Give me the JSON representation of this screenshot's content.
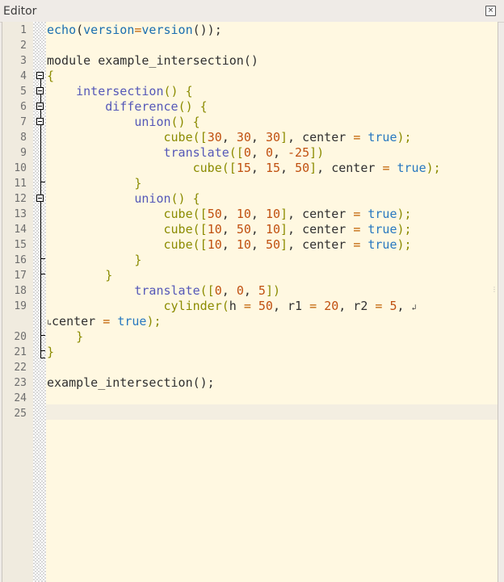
{
  "window": {
    "title": "Editor",
    "close_glyph": "×"
  },
  "gutter": {
    "line_numbers": [
      "1",
      "2",
      "3",
      "4",
      "5",
      "6",
      "7",
      "8",
      "9",
      "10",
      "11",
      "12",
      "13",
      "14",
      "15",
      "16",
      "17",
      "18",
      "19",
      "20",
      "21",
      "22",
      "23",
      "24",
      "25"
    ]
  },
  "code": {
    "lines": [
      [
        [
          "fn",
          "echo"
        ],
        [
          "plain",
          "("
        ],
        [
          "fn",
          "version"
        ],
        [
          "op",
          "="
        ],
        [
          "fn",
          "version"
        ],
        [
          "plain",
          "());"
        ]
      ],
      [],
      [
        [
          "plain",
          "module example_intersection()"
        ]
      ],
      [
        [
          "fn2",
          "{"
        ]
      ],
      [
        [
          "plain",
          "    "
        ],
        [
          "kw",
          "intersection"
        ],
        [
          "fn2",
          "() {"
        ]
      ],
      [
        [
          "plain",
          "        "
        ],
        [
          "kw",
          "difference"
        ],
        [
          "fn2",
          "() {"
        ]
      ],
      [
        [
          "plain",
          "            "
        ],
        [
          "kw",
          "union"
        ],
        [
          "fn2",
          "() {"
        ]
      ],
      [
        [
          "plain",
          "                "
        ],
        [
          "fn2",
          "cube(["
        ],
        [
          "num",
          "30"
        ],
        [
          "plain",
          ", "
        ],
        [
          "num",
          "30"
        ],
        [
          "plain",
          ", "
        ],
        [
          "num",
          "30"
        ],
        [
          "fn2",
          "]"
        ],
        [
          "plain",
          ", center "
        ],
        [
          "op",
          "="
        ],
        [
          "plain",
          " "
        ],
        [
          "bool",
          "true"
        ],
        [
          "fn2",
          ");"
        ]
      ],
      [
        [
          "plain",
          "                "
        ],
        [
          "kw",
          "translate"
        ],
        [
          "fn2",
          "(["
        ],
        [
          "num",
          "0"
        ],
        [
          "plain",
          ", "
        ],
        [
          "num",
          "0"
        ],
        [
          "plain",
          ", "
        ],
        [
          "num",
          "-25"
        ],
        [
          "fn2",
          "])"
        ]
      ],
      [
        [
          "plain",
          "                    "
        ],
        [
          "fn2",
          "cube(["
        ],
        [
          "num",
          "15"
        ],
        [
          "plain",
          ", "
        ],
        [
          "num",
          "15"
        ],
        [
          "plain",
          ", "
        ],
        [
          "num",
          "50"
        ],
        [
          "fn2",
          "]"
        ],
        [
          "plain",
          ", center "
        ],
        [
          "op",
          "="
        ],
        [
          "plain",
          " "
        ],
        [
          "bool",
          "true"
        ],
        [
          "fn2",
          ");"
        ]
      ],
      [
        [
          "plain",
          "            "
        ],
        [
          "fn2",
          "}"
        ]
      ],
      [
        [
          "plain",
          "            "
        ],
        [
          "kw",
          "union"
        ],
        [
          "fn2",
          "() {"
        ]
      ],
      [
        [
          "plain",
          "                "
        ],
        [
          "fn2",
          "cube(["
        ],
        [
          "num",
          "50"
        ],
        [
          "plain",
          ", "
        ],
        [
          "num",
          "10"
        ],
        [
          "plain",
          ", "
        ],
        [
          "num",
          "10"
        ],
        [
          "fn2",
          "]"
        ],
        [
          "plain",
          ", center "
        ],
        [
          "op",
          "="
        ],
        [
          "plain",
          " "
        ],
        [
          "bool",
          "true"
        ],
        [
          "fn2",
          ");"
        ]
      ],
      [
        [
          "plain",
          "                "
        ],
        [
          "fn2",
          "cube(["
        ],
        [
          "num",
          "10"
        ],
        [
          "plain",
          ", "
        ],
        [
          "num",
          "50"
        ],
        [
          "plain",
          ", "
        ],
        [
          "num",
          "10"
        ],
        [
          "fn2",
          "]"
        ],
        [
          "plain",
          ", center "
        ],
        [
          "op",
          "="
        ],
        [
          "plain",
          " "
        ],
        [
          "bool",
          "true"
        ],
        [
          "fn2",
          ");"
        ]
      ],
      [
        [
          "plain",
          "                "
        ],
        [
          "fn2",
          "cube(["
        ],
        [
          "num",
          "10"
        ],
        [
          "plain",
          ", "
        ],
        [
          "num",
          "10"
        ],
        [
          "plain",
          ", "
        ],
        [
          "num",
          "50"
        ],
        [
          "fn2",
          "]"
        ],
        [
          "plain",
          ", center "
        ],
        [
          "op",
          "="
        ],
        [
          "plain",
          " "
        ],
        [
          "bool",
          "true"
        ],
        [
          "fn2",
          ");"
        ]
      ],
      [
        [
          "plain",
          "            "
        ],
        [
          "fn2",
          "}"
        ]
      ],
      [
        [
          "plain",
          "        "
        ],
        [
          "fn2",
          "}"
        ]
      ],
      [
        [
          "plain",
          "            "
        ],
        [
          "kw",
          "translate"
        ],
        [
          "fn2",
          "(["
        ],
        [
          "num",
          "0"
        ],
        [
          "plain",
          ", "
        ],
        [
          "num",
          "0"
        ],
        [
          "plain",
          ", "
        ],
        [
          "num",
          "5"
        ],
        [
          "fn2",
          "])"
        ]
      ],
      [
        [
          "plain",
          "                "
        ],
        [
          "fn2",
          "cylinder("
        ],
        [
          "plain",
          "h "
        ],
        [
          "op",
          "="
        ],
        [
          "plain",
          " "
        ],
        [
          "num",
          "50"
        ],
        [
          "plain",
          ", r1 "
        ],
        [
          "op",
          "="
        ],
        [
          "plain",
          " "
        ],
        [
          "num",
          "20"
        ],
        [
          "plain",
          ", r2 "
        ],
        [
          "op",
          "="
        ],
        [
          "plain",
          " "
        ],
        [
          "num",
          "5"
        ],
        [
          "plain",
          ", "
        ]
      ],
      [
        [
          "plain",
          "center "
        ],
        [
          "op",
          "="
        ],
        [
          "plain",
          " "
        ],
        [
          "bool",
          "true"
        ],
        [
          "fn2",
          ");"
        ]
      ],
      [
        [
          "plain",
          "    "
        ],
        [
          "fn2",
          "}"
        ]
      ],
      [
        [
          "fn2",
          "}"
        ]
      ],
      [],
      [
        [
          "plain",
          "example_intersection();"
        ]
      ],
      [],
      []
    ],
    "wrap_glyph_end": "↲",
    "wrap_glyph_start": "↳"
  },
  "colors": {
    "editor_bg": "#fff8e1",
    "gutter_bg": "#f0ebdf",
    "current_line": "#f3eee1"
  }
}
